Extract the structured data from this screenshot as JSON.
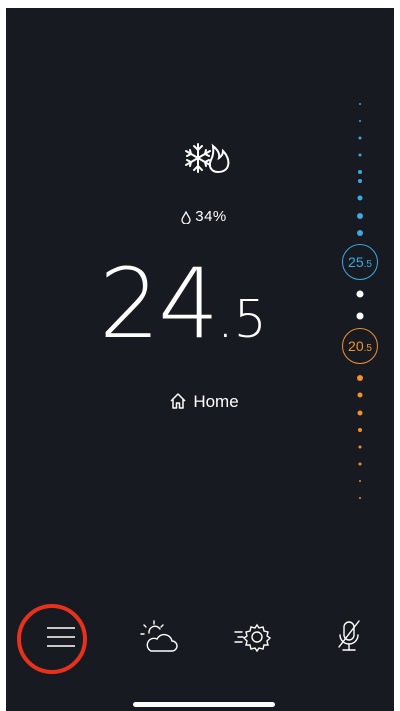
{
  "status": {
    "mode_icon": "snowflake-flame-icon",
    "humidity": "34%",
    "humidity_icon": "droplet-icon"
  },
  "temperature": {
    "integer": "24",
    "decimal": ".5"
  },
  "location": {
    "label": "Home",
    "icon": "home-icon"
  },
  "setpoints": {
    "cool": {
      "int": "25",
      "dec": ".5",
      "color": "#3ea9e0"
    },
    "heat": {
      "int": "20",
      "dec": ".5",
      "color": "#f0902f"
    }
  },
  "nav": {
    "items": [
      {
        "icon": "menu-icon"
      },
      {
        "icon": "weather-icon"
      },
      {
        "icon": "fast-settings-icon"
      },
      {
        "icon": "microphone-off-icon"
      }
    ],
    "highlight_color": "#e8311d"
  }
}
